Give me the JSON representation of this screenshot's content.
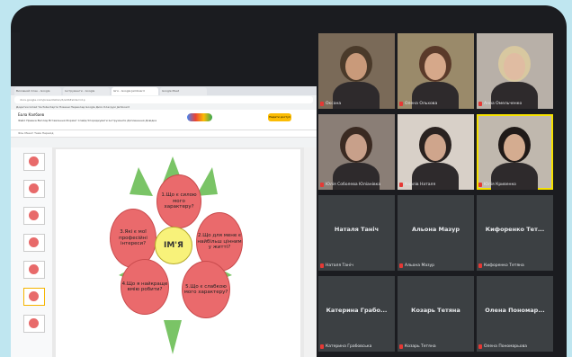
{
  "browser": {
    "tabs": [
      "Виховний план - Google",
      "Інструменти - Google",
      "Ім'я - Google Jamboard",
      "Google Meet"
    ],
    "url": "docs.google.com/presentation/d/edit#slide=id.p",
    "bookmarks": "Додатки  Gmail  YouTube  Карти  Новини  Переклад  Google Диск  Класрум  Jamboard"
  },
  "doc": {
    "title": "Бала Калбаев",
    "menu": "Файл  Правка  Вигляд  Вставлення  Формат  Слайд  Упорядкувати  Інструменти  Доповнення  Довідка",
    "toolbar": "Фон  Макет  Тема  Перехід",
    "share_label": "Надати доступ"
  },
  "flower": {
    "center": "ІМ'Я",
    "petals": [
      "1.Що є силою мого характеру?",
      "2.Що для мене є найбільш цінним у житті?",
      "3.Які є мої професійні інтереси?",
      "4.Що я найкраще вмію робити?",
      "5.Що є слабкою мого характеру?"
    ]
  },
  "participants": [
    {
      "name": "Оксана",
      "kind": "video",
      "skin": "#c99a7a",
      "bg": "#7a6a58",
      "hair": "#4a3a2a"
    },
    {
      "name": "Олена Ольхова",
      "kind": "video",
      "skin": "#d6a88a",
      "bg": "#9a8a6a",
      "hair": "#5a3a2a"
    },
    {
      "name": "Анна Омельченко",
      "kind": "video",
      "skin": "#e0bca2",
      "bg": "#b8b0a8",
      "hair": "#d8c8a0"
    },
    {
      "name": "Юлія Соболева Юліанівка",
      "kind": "video",
      "skin": "#c8a08a",
      "bg": "#8a7e76",
      "hair": "#3a2a22"
    },
    {
      "name": "Карлів Наталя",
      "kind": "video",
      "skin": "#cfa58c",
      "bg": "#d8d0c8",
      "hair": "#2a2220"
    },
    {
      "name": "Юлія Кривенко",
      "kind": "video",
      "skin": "#d4ac90",
      "bg": "#c0b8ae",
      "hair": "#201a18"
    },
    {
      "name": "Наталя Таніч",
      "kind": "name",
      "display": "Наталя Таніч"
    },
    {
      "name": "Альона Мазур",
      "kind": "name",
      "display": "Альона Мазур"
    },
    {
      "name": "Кифоренко Тетяна",
      "kind": "name",
      "display": "Кифоренко Тет..."
    },
    {
      "name": "Катерина Грабовська",
      "kind": "name",
      "display": "Катерина Грабо..."
    },
    {
      "name": "Козарь Тетяна",
      "kind": "name",
      "display": "Козарь Тетяна"
    },
    {
      "name": "Олена Пономарьова",
      "kind": "name",
      "display": "Олена Пономар..."
    }
  ]
}
